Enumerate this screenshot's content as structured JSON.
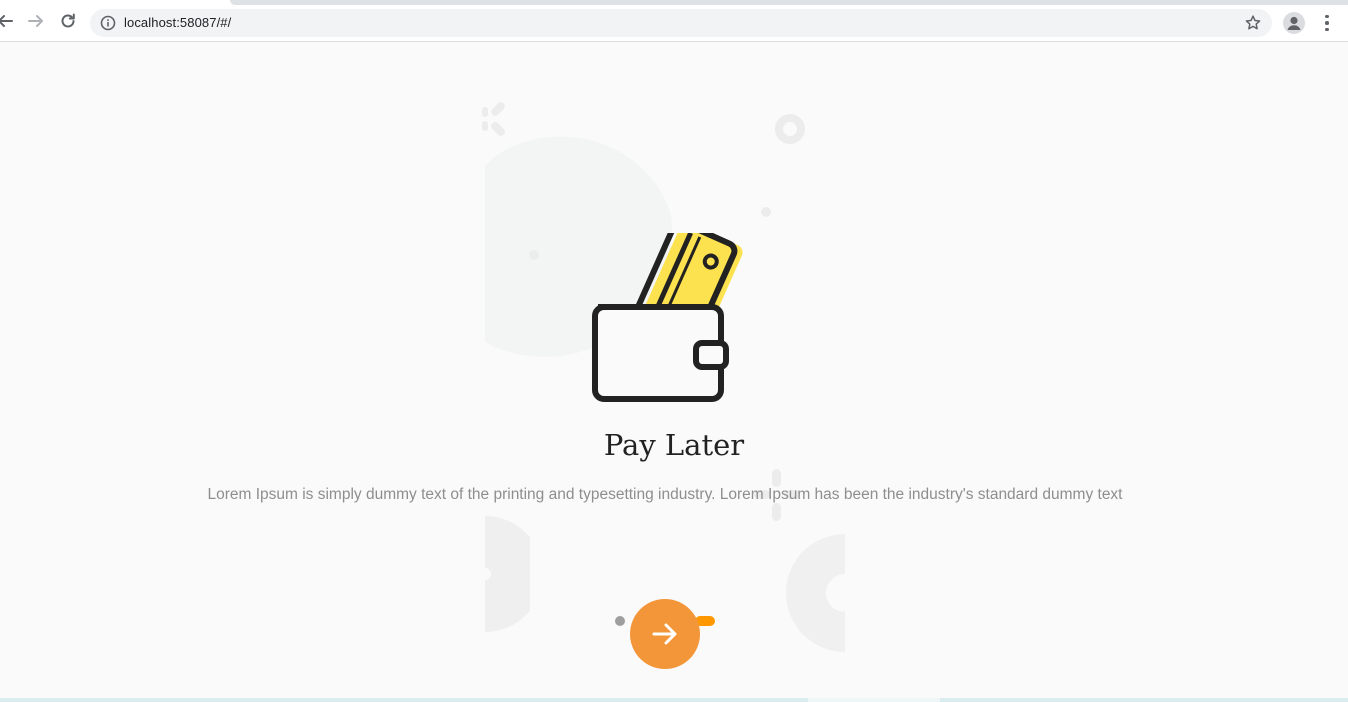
{
  "browser": {
    "url": "localhost:58087/#/",
    "icons": {
      "back": "arrow-left-icon",
      "forward": "arrow-right-icon",
      "reload": "reload-icon",
      "info": "info-icon",
      "bookmark": "star-icon",
      "profile": "person-icon",
      "menu": "kebab-menu-icon"
    }
  },
  "onboarding": {
    "title": "Pay Later",
    "description": "Lorem Ipsum is simply dummy text of the printing and typesetting industry. Lorem Ipsum has been the industry's standard dummy text",
    "illustration": "wallet-card-icon",
    "next_icon": "arrow-right-icon",
    "pagination": {
      "total": 2,
      "active": 2
    },
    "colors": {
      "accent": "#f3963a",
      "active_dot": "#ff9800",
      "inactive_dot": "#9e9e9e",
      "card": "#fde24f",
      "outline": "#222222",
      "decoration": "#efefef"
    }
  }
}
